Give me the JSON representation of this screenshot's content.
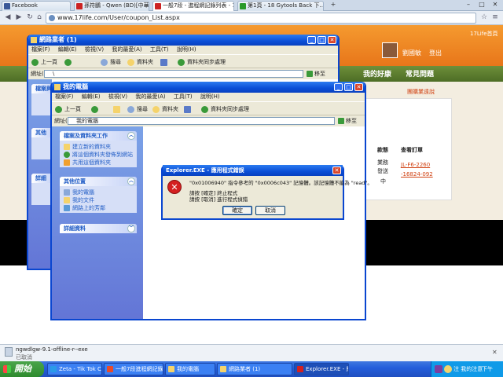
{
  "browser": {
    "tabs": [
      {
        "label": "Facebook",
        "fav_color": "#3b5998"
      },
      {
        "label": "孫符鵬 - Qwen (BD)[中華字幕...",
        "fav_color": "#cc2222"
      },
      {
        "label": "一般7段 - 進程網記錄列表 - 17LIFE",
        "fav_color": "#cc2222"
      },
      {
        "label": "第1頁 - 18 Gytools Back 下...",
        "fav_color": "#2a9a2a"
      }
    ],
    "new_tab": "+",
    "window_controls": [
      "–",
      "□",
      "✕"
    ],
    "url": "www.17life.com/User/coupon_List.aspx"
  },
  "site": {
    "brand_small": "17Life首頁",
    "user_name": "劉國敏",
    "logout": "登出",
    "nav": [
      "我的好康",
      "常見問題"
    ],
    "promo": "團購業遠說",
    "table_headers": [
      "款態",
      "查看訂單"
    ],
    "table_rows": [
      [
        "業務",
        "JL-F6-2260"
      ],
      [
        "發送",
        "-16824-092"
      ],
      [
        "中",
        ""
      ]
    ]
  },
  "win_back": {
    "title": "網路業者 (1)",
    "menu": [
      "檔案(F)",
      "編輯(E)",
      "檢視(V)",
      "我的最愛(A)",
      "工具(T)",
      "說明(H)"
    ],
    "toolbar": [
      "上一頁",
      "搜尋",
      "資料夾",
      "資料夾同步處理"
    ],
    "address_label": "網址(D)",
    "address": "\\",
    "go": "移至",
    "panel_heads": [
      "檔案與",
      "其他",
      "詳細"
    ]
  },
  "win_front": {
    "title": "我的電腦",
    "menu": [
      "檔案(F)",
      "編輯(E)",
      "檢視(V)",
      "我的最愛(A)",
      "工具(T)",
      "說明(H)"
    ],
    "toolbar": [
      "上一頁",
      "搜尋",
      "資料夾",
      "資料夾同步處理"
    ],
    "address_label": "網址(D)",
    "address": "我的電腦",
    "go": "移至",
    "panel1": {
      "title": "檔案及資料夾工作",
      "items": [
        "建立新的資料夾",
        "將這個資料夾發佈到網站",
        "共用這個資料夾"
      ]
    },
    "panel2": {
      "title": "其他位置",
      "items": [
        "我的電腦",
        "我的文件",
        "網路上的芳鄰"
      ]
    },
    "panel3": {
      "title": "詳細資料",
      "items": []
    }
  },
  "error_dialog": {
    "title": "Explorer.EXE - 應用程式錯誤",
    "line1": "\"0x01006940\" 指令參考的 \"0x0006c043\" 記憶體。該記憶體不能為 \"read\"。",
    "line2": "請按 [確定] 終止程式",
    "line3": "請按 [取消] 進行程式偵錯",
    "ok": "確定",
    "cancel": "取消",
    "close": "✕",
    "icon_glyph": "✕"
  },
  "download": {
    "file": "ngwdlgw-9.1-offline-r--exe",
    "status": "已取消"
  },
  "taskbar": {
    "start": "開始",
    "tasks": [
      "Zeta - Tik Tok Chat...",
      "一般7段進程網記錄...",
      "我的電腦",
      "網路業者 (1)",
      "Explorer.EXE - 應用..."
    ],
    "tray_text": "注 我的注意",
    "clock": "下午 02:27"
  },
  "colors": {
    "site_orange": "#e8761a",
    "site_green": "#5b7d2e",
    "xp_blue": "#0a4ed6",
    "error_red": "#d42020"
  }
}
